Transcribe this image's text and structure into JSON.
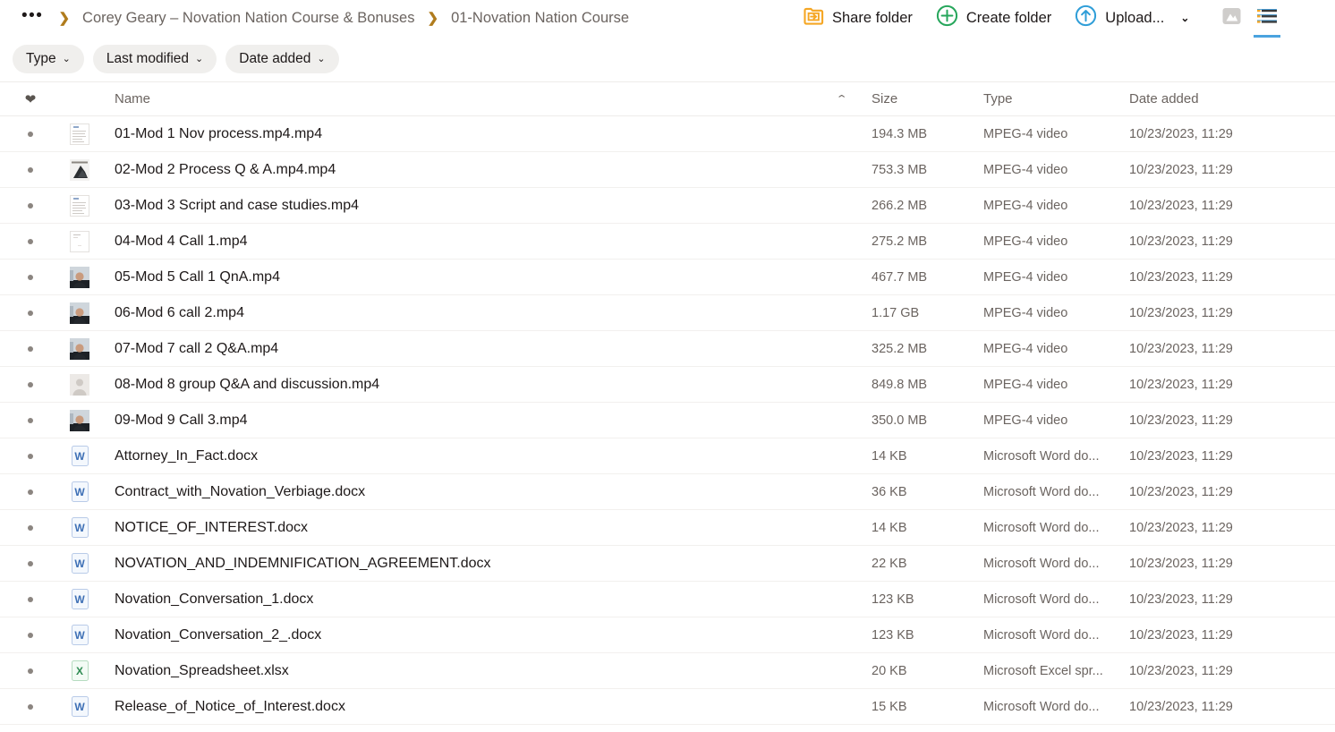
{
  "breadcrumb": {
    "overflow_label": "•••",
    "separator": "❯",
    "items": [
      {
        "label": "Corey Geary – Novation Nation Course & Bonuses"
      },
      {
        "label": "01-Novation Nation Course"
      }
    ]
  },
  "toolbar": {
    "share_folder_label": "Share folder",
    "create_folder_label": "Create folder",
    "upload_label": "Upload...",
    "upload_caret": "⌄",
    "share_icon": "share-folder-icon",
    "create_icon": "plus-circle-icon",
    "upload_icon": "upload-circle-icon",
    "grid_view_icon": "image-grid-view-icon",
    "list_view_icon": "list-view-icon"
  },
  "filters": [
    {
      "label": "Type",
      "caret": "⌄"
    },
    {
      "label": "Last modified",
      "caret": "⌄"
    },
    {
      "label": "Date added",
      "caret": "⌄"
    }
  ],
  "columns": {
    "favorite_icon": "heart-icon",
    "name": "Name",
    "sort_caret": "⌃",
    "size": "Size",
    "type": "Type",
    "date_added": "Date added"
  },
  "files": [
    {
      "name": "01-Mod 1 Nov process.mp4.mp4",
      "size": "194.3 MB",
      "type": "MPEG-4 video",
      "date": "10/23/2023, 11:29",
      "icon": "video-thumbnail-document"
    },
    {
      "name": "02-Mod 2 Process Q & A.mp4.mp4",
      "size": "753.3 MB",
      "type": "MPEG-4 video",
      "date": "10/23/2023, 11:29",
      "icon": "video-thumbnail-dark"
    },
    {
      "name": "03-Mod 3 Script and case studies.mp4",
      "size": "266.2 MB",
      "type": "MPEG-4 video",
      "date": "10/23/2023, 11:29",
      "icon": "video-thumbnail-document"
    },
    {
      "name": "04-Mod 4 Call 1.mp4",
      "size": "275.2 MB",
      "type": "MPEG-4 video",
      "date": "10/23/2023, 11:29",
      "icon": "video-thumbnail-light"
    },
    {
      "name": "05-Mod 5 Call 1 QnA.mp4",
      "size": "467.7 MB",
      "type": "MPEG-4 video",
      "date": "10/23/2023, 11:29",
      "icon": "video-thumbnail-person"
    },
    {
      "name": "06-Mod 6 call 2.mp4",
      "size": "1.17 GB",
      "type": "MPEG-4 video",
      "date": "10/23/2023, 11:29",
      "icon": "video-thumbnail-person"
    },
    {
      "name": "07-Mod 7 call 2 Q&A.mp4",
      "size": "325.2 MB",
      "type": "MPEG-4 video",
      "date": "10/23/2023, 11:29",
      "icon": "video-thumbnail-person"
    },
    {
      "name": "08-Mod 8 group Q&A and discussion.mp4",
      "size": "849.8 MB",
      "type": "MPEG-4 video",
      "date": "10/23/2023, 11:29",
      "icon": "avatar-placeholder-icon"
    },
    {
      "name": "09-Mod 9 Call 3.mp4",
      "size": "350.0 MB",
      "type": "MPEG-4 video",
      "date": "10/23/2023, 11:29",
      "icon": "video-thumbnail-person"
    },
    {
      "name": "Attorney_In_Fact.docx",
      "size": "14 KB",
      "type": "Microsoft Word do...",
      "date": "10/23/2023, 11:29",
      "icon": "word-doc-icon",
      "glyph": "W"
    },
    {
      "name": "Contract_with_Novation_Verbiage.docx",
      "size": "36 KB",
      "type": "Microsoft Word do...",
      "date": "10/23/2023, 11:29",
      "icon": "word-doc-icon",
      "glyph": "W"
    },
    {
      "name": "NOTICE_OF_INTEREST.docx",
      "size": "14 KB",
      "type": "Microsoft Word do...",
      "date": "10/23/2023, 11:29",
      "icon": "word-doc-icon",
      "glyph": "W"
    },
    {
      "name": "NOVATION_AND_INDEMNIFICATION_AGREEMENT.docx",
      "size": "22 KB",
      "type": "Microsoft Word do...",
      "date": "10/23/2023, 11:29",
      "icon": "word-doc-icon",
      "glyph": "W"
    },
    {
      "name": "Novation_Conversation_1.docx",
      "size": "123 KB",
      "type": "Microsoft Word do...",
      "date": "10/23/2023, 11:29",
      "icon": "word-doc-icon",
      "glyph": "W"
    },
    {
      "name": "Novation_Conversation_2_.docx",
      "size": "123 KB",
      "type": "Microsoft Word do...",
      "date": "10/23/2023, 11:29",
      "icon": "word-doc-icon",
      "glyph": "W"
    },
    {
      "name": "Novation_Spreadsheet.xlsx",
      "size": "20 KB",
      "type": "Microsoft Excel spr...",
      "date": "10/23/2023, 11:29",
      "icon": "excel-sheet-icon",
      "glyph": "X"
    },
    {
      "name": "Release_of_Notice_of_Interest.docx",
      "size": "15 KB",
      "type": "Microsoft Word do...",
      "date": "10/23/2023, 11:29",
      "icon": "word-doc-icon",
      "glyph": "W"
    }
  ],
  "colors": {
    "share_orange": "#f5a623",
    "create_green": "#26a65b",
    "upload_blue": "#2f9ed8",
    "active_tab_blue": "#4aa3df",
    "breadcrumb_sep": "#b07c1d",
    "text_primary": "#1e1919",
    "text_muted": "#6b6460",
    "chip_bg": "#f0efed"
  }
}
